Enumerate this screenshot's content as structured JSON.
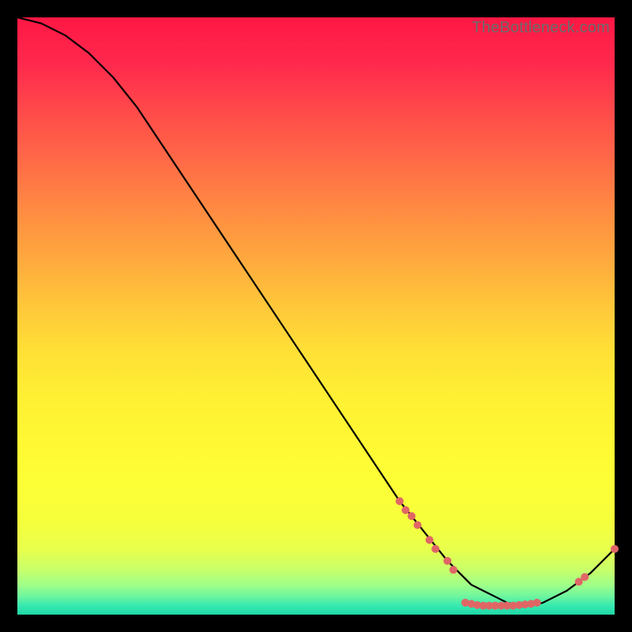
{
  "watermark": "TheBottleneck.com",
  "chart_data": {
    "type": "line",
    "title": "",
    "xlabel": "",
    "ylabel": "",
    "xlim": [
      0,
      100
    ],
    "ylim": [
      0,
      100
    ],
    "grid": false,
    "legend": false,
    "series": [
      {
        "name": "curve",
        "color": "#000000",
        "x": [
          0,
          4,
          8,
          12,
          16,
          20,
          24,
          28,
          32,
          36,
          40,
          44,
          48,
          52,
          56,
          60,
          64,
          68,
          72,
          74,
          76,
          78,
          80,
          82,
          84,
          86,
          88,
          92,
          96,
          100
        ],
        "y": [
          100,
          99,
          97,
          94,
          90,
          85,
          79,
          73,
          67,
          61,
          55,
          49,
          43,
          37,
          31,
          25,
          19,
          14,
          9,
          7,
          5,
          4,
          3,
          2,
          1.5,
          1.5,
          2,
          4,
          7,
          11
        ]
      }
    ],
    "markers": [
      {
        "name": "highlight-points",
        "shape": "circle",
        "color": "#e06666",
        "radius": 5,
        "points": [
          {
            "x": 64.0,
            "y": 19.0
          },
          {
            "x": 65.0,
            "y": 17.5
          },
          {
            "x": 66.0,
            "y": 16.5
          },
          {
            "x": 67.0,
            "y": 15.0
          },
          {
            "x": 69.0,
            "y": 12.5
          },
          {
            "x": 70.0,
            "y": 11.0
          },
          {
            "x": 72.0,
            "y": 9.0
          },
          {
            "x": 73.0,
            "y": 7.5
          },
          {
            "x": 75.0,
            "y": 2.0
          },
          {
            "x": 76.0,
            "y": 1.8
          },
          {
            "x": 77.0,
            "y": 1.6
          },
          {
            "x": 78.0,
            "y": 1.5
          },
          {
            "x": 79.0,
            "y": 1.5
          },
          {
            "x": 80.0,
            "y": 1.5
          },
          {
            "x": 81.0,
            "y": 1.5
          },
          {
            "x": 82.0,
            "y": 1.5
          },
          {
            "x": 83.0,
            "y": 1.5
          },
          {
            "x": 84.0,
            "y": 1.6
          },
          {
            "x": 85.0,
            "y": 1.7
          },
          {
            "x": 86.0,
            "y": 1.8
          },
          {
            "x": 87.0,
            "y": 2.0
          },
          {
            "x": 94.0,
            "y": 5.5
          },
          {
            "x": 95.0,
            "y": 6.3
          },
          {
            "x": 100.0,
            "y": 11.0
          }
        ]
      }
    ]
  }
}
